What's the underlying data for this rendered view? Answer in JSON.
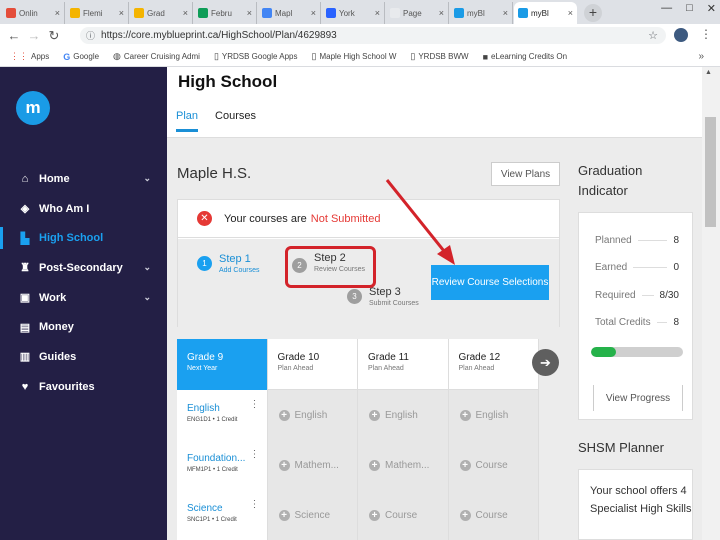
{
  "browser": {
    "tabs": [
      {
        "label": "Onlin",
        "color": "#e44d3a",
        "active": false
      },
      {
        "label": "Flemi",
        "color": "#f4b400",
        "active": false
      },
      {
        "label": "Grad",
        "color": "#f4b400",
        "active": false
      },
      {
        "label": "Febru",
        "color": "#0f9d58",
        "active": false
      },
      {
        "label": "Mapl",
        "color": "#4285f4",
        "active": false
      },
      {
        "label": "York",
        "color": "#2962ff",
        "active": false
      },
      {
        "label": "Page",
        "color": "#e8eaed",
        "active": false
      },
      {
        "label": "myBl",
        "color": "#1a9be6",
        "active": false
      },
      {
        "label": "myBl",
        "color": "#1a9be6",
        "active": true
      }
    ],
    "new_tab": "+",
    "window_controls": [
      "—",
      "□",
      "✕"
    ],
    "url": "https://core.myblueprint.ca/HighSchool/Plan/4629893",
    "bookmarks": [
      {
        "label": "Apps",
        "icon": "grid-icon"
      },
      {
        "label": "Google",
        "icon": "google-icon"
      },
      {
        "label": "Career Cruising Admi",
        "icon": "globe-icon"
      },
      {
        "label": "YRDSB Google Apps",
        "icon": "doc-icon"
      },
      {
        "label": "Maple High School W",
        "icon": "doc-icon"
      },
      {
        "label": "YRDSB BWW",
        "icon": "doc-icon"
      },
      {
        "label": "eLearning Credits On",
        "icon": "ssm-icon"
      }
    ],
    "bookmarks_more": "»"
  },
  "sidebar": {
    "logo": "m",
    "items": [
      {
        "label": "Home",
        "icon": "home-icon",
        "has_chevron": true,
        "active": false
      },
      {
        "label": "Who Am I",
        "icon": "compass-icon",
        "has_chevron": false,
        "active": false
      },
      {
        "label": "High School",
        "icon": "chart-icon",
        "has_chevron": false,
        "active": true
      },
      {
        "label": "Post-Secondary",
        "icon": "grad-cap-icon",
        "has_chevron": true,
        "active": false
      },
      {
        "label": "Work",
        "icon": "briefcase-icon",
        "has_chevron": true,
        "active": false
      },
      {
        "label": "Money",
        "icon": "money-icon",
        "has_chevron": false,
        "active": false
      },
      {
        "label": "Guides",
        "icon": "book-icon",
        "has_chevron": false,
        "active": false
      },
      {
        "label": "Favourites",
        "icon": "heart-icon",
        "has_chevron": false,
        "active": false
      }
    ]
  },
  "main": {
    "title": "High School",
    "tabs": [
      {
        "label": "Plan",
        "active": true
      },
      {
        "label": "Courses",
        "active": false
      }
    ],
    "school": "Maple H.S.",
    "view_plans": "View Plans",
    "status": {
      "prefix": "Your courses are",
      "state": "Not Submitted"
    },
    "steps": [
      {
        "num": "1",
        "title": "Step 1",
        "sub": "Add Courses",
        "state": "done"
      },
      {
        "num": "2",
        "title": "Step 2",
        "sub": "Review Courses",
        "state": "current"
      },
      {
        "num": "3",
        "title": "Step 3",
        "sub": "Submit Courses",
        "state": "todo"
      }
    ],
    "review_button": "Review Course Selections",
    "grades": [
      {
        "title": "Grade 9",
        "sub": "Next Year",
        "active": true
      },
      {
        "title": "Grade 10",
        "sub": "Plan Ahead",
        "active": false
      },
      {
        "title": "Grade 11",
        "sub": "Plan Ahead",
        "active": false
      },
      {
        "title": "Grade 12",
        "sub": "Plan Ahead",
        "active": false
      }
    ],
    "next_arrow": "➔",
    "rows": [
      {
        "course": "English",
        "code": "ENG1D1 • 1 Credit",
        "placeholders": [
          "English",
          "English",
          "English"
        ]
      },
      {
        "course": "Foundation...",
        "code": "MFM1P1 • 1 Credit",
        "placeholders": [
          "Mathem...",
          "Mathem...",
          "Course"
        ]
      },
      {
        "course": "Science",
        "code": "SNC1P1 • 1 Credit",
        "placeholders": [
          "Science",
          "Course",
          "Course"
        ]
      }
    ]
  },
  "graduation": {
    "title": "Graduation Indicator",
    "stats": [
      {
        "label": "Planned",
        "value": "8"
      },
      {
        "label": "Earned",
        "value": "0"
      },
      {
        "label": "Required",
        "value": "8/30"
      },
      {
        "label": "Total Credits",
        "value": "8"
      }
    ],
    "progress_fraction": 0.27,
    "progress_color": "#25b24a",
    "view_progress": "View Progress"
  },
  "shsm": {
    "title": "SHSM Planner",
    "text": "Your school offers 4 Specialist High Skills"
  },
  "colors": {
    "accent": "#1aa0f0",
    "sidebar": "#231f45",
    "error": "#e53935",
    "annotation": "#d3232a"
  }
}
